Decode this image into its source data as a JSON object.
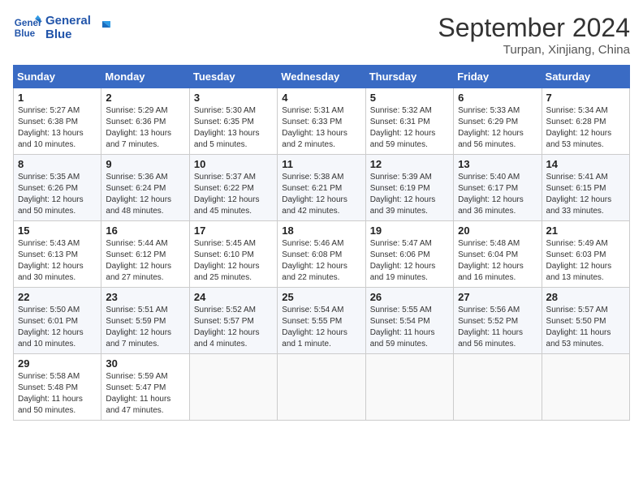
{
  "header": {
    "logo_line1": "General",
    "logo_line2": "Blue",
    "month": "September 2024",
    "location": "Turpan, Xinjiang, China"
  },
  "weekdays": [
    "Sunday",
    "Monday",
    "Tuesday",
    "Wednesday",
    "Thursday",
    "Friday",
    "Saturday"
  ],
  "weeks": [
    [
      {
        "day": "1",
        "info": "Sunrise: 5:27 AM\nSunset: 6:38 PM\nDaylight: 13 hours and 10 minutes."
      },
      {
        "day": "2",
        "info": "Sunrise: 5:29 AM\nSunset: 6:36 PM\nDaylight: 13 hours and 7 minutes."
      },
      {
        "day": "3",
        "info": "Sunrise: 5:30 AM\nSunset: 6:35 PM\nDaylight: 13 hours and 5 minutes."
      },
      {
        "day": "4",
        "info": "Sunrise: 5:31 AM\nSunset: 6:33 PM\nDaylight: 13 hours and 2 minutes."
      },
      {
        "day": "5",
        "info": "Sunrise: 5:32 AM\nSunset: 6:31 PM\nDaylight: 12 hours and 59 minutes."
      },
      {
        "day": "6",
        "info": "Sunrise: 5:33 AM\nSunset: 6:29 PM\nDaylight: 12 hours and 56 minutes."
      },
      {
        "day": "7",
        "info": "Sunrise: 5:34 AM\nSunset: 6:28 PM\nDaylight: 12 hours and 53 minutes."
      }
    ],
    [
      {
        "day": "8",
        "info": "Sunrise: 5:35 AM\nSunset: 6:26 PM\nDaylight: 12 hours and 50 minutes."
      },
      {
        "day": "9",
        "info": "Sunrise: 5:36 AM\nSunset: 6:24 PM\nDaylight: 12 hours and 48 minutes."
      },
      {
        "day": "10",
        "info": "Sunrise: 5:37 AM\nSunset: 6:22 PM\nDaylight: 12 hours and 45 minutes."
      },
      {
        "day": "11",
        "info": "Sunrise: 5:38 AM\nSunset: 6:21 PM\nDaylight: 12 hours and 42 minutes."
      },
      {
        "day": "12",
        "info": "Sunrise: 5:39 AM\nSunset: 6:19 PM\nDaylight: 12 hours and 39 minutes."
      },
      {
        "day": "13",
        "info": "Sunrise: 5:40 AM\nSunset: 6:17 PM\nDaylight: 12 hours and 36 minutes."
      },
      {
        "day": "14",
        "info": "Sunrise: 5:41 AM\nSunset: 6:15 PM\nDaylight: 12 hours and 33 minutes."
      }
    ],
    [
      {
        "day": "15",
        "info": "Sunrise: 5:43 AM\nSunset: 6:13 PM\nDaylight: 12 hours and 30 minutes."
      },
      {
        "day": "16",
        "info": "Sunrise: 5:44 AM\nSunset: 6:12 PM\nDaylight: 12 hours and 27 minutes."
      },
      {
        "day": "17",
        "info": "Sunrise: 5:45 AM\nSunset: 6:10 PM\nDaylight: 12 hours and 25 minutes."
      },
      {
        "day": "18",
        "info": "Sunrise: 5:46 AM\nSunset: 6:08 PM\nDaylight: 12 hours and 22 minutes."
      },
      {
        "day": "19",
        "info": "Sunrise: 5:47 AM\nSunset: 6:06 PM\nDaylight: 12 hours and 19 minutes."
      },
      {
        "day": "20",
        "info": "Sunrise: 5:48 AM\nSunset: 6:04 PM\nDaylight: 12 hours and 16 minutes."
      },
      {
        "day": "21",
        "info": "Sunrise: 5:49 AM\nSunset: 6:03 PM\nDaylight: 12 hours and 13 minutes."
      }
    ],
    [
      {
        "day": "22",
        "info": "Sunrise: 5:50 AM\nSunset: 6:01 PM\nDaylight: 12 hours and 10 minutes."
      },
      {
        "day": "23",
        "info": "Sunrise: 5:51 AM\nSunset: 5:59 PM\nDaylight: 12 hours and 7 minutes."
      },
      {
        "day": "24",
        "info": "Sunrise: 5:52 AM\nSunset: 5:57 PM\nDaylight: 12 hours and 4 minutes."
      },
      {
        "day": "25",
        "info": "Sunrise: 5:54 AM\nSunset: 5:55 PM\nDaylight: 12 hours and 1 minute."
      },
      {
        "day": "26",
        "info": "Sunrise: 5:55 AM\nSunset: 5:54 PM\nDaylight: 11 hours and 59 minutes."
      },
      {
        "day": "27",
        "info": "Sunrise: 5:56 AM\nSunset: 5:52 PM\nDaylight: 11 hours and 56 minutes."
      },
      {
        "day": "28",
        "info": "Sunrise: 5:57 AM\nSunset: 5:50 PM\nDaylight: 11 hours and 53 minutes."
      }
    ],
    [
      {
        "day": "29",
        "info": "Sunrise: 5:58 AM\nSunset: 5:48 PM\nDaylight: 11 hours and 50 minutes."
      },
      {
        "day": "30",
        "info": "Sunrise: 5:59 AM\nSunset: 5:47 PM\nDaylight: 11 hours and 47 minutes."
      },
      {
        "day": "",
        "info": ""
      },
      {
        "day": "",
        "info": ""
      },
      {
        "day": "",
        "info": ""
      },
      {
        "day": "",
        "info": ""
      },
      {
        "day": "",
        "info": ""
      }
    ]
  ]
}
